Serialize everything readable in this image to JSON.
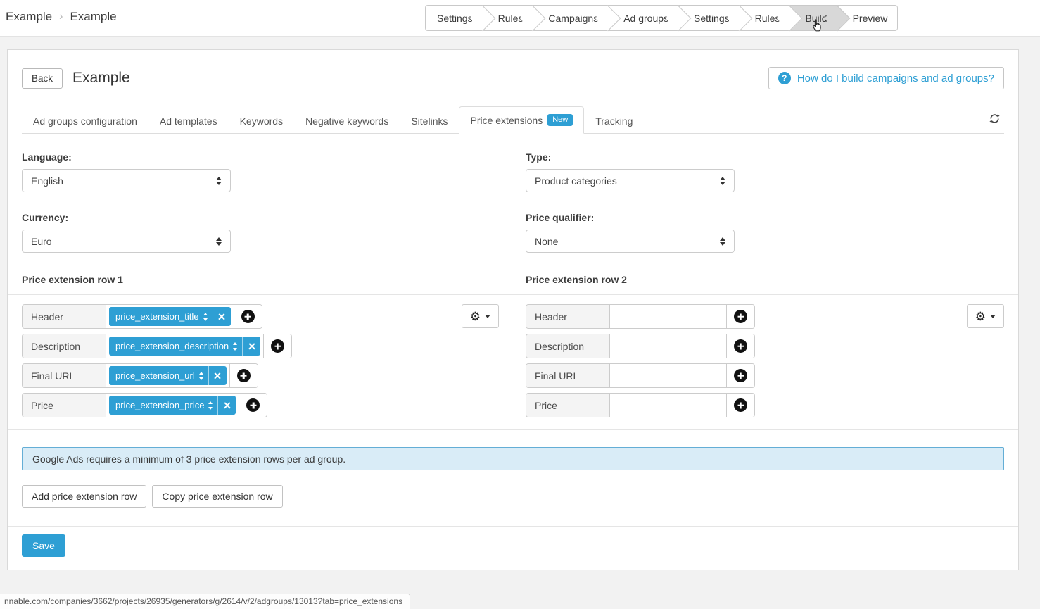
{
  "breadcrumb": {
    "items": [
      "Example",
      "Example"
    ],
    "separator": "›"
  },
  "wizard_nav": {
    "steps": [
      {
        "label": "Settings",
        "active": false
      },
      {
        "label": "Rules",
        "active": false
      },
      {
        "label": "Campaigns",
        "active": false
      },
      {
        "label": "Ad groups",
        "active": false
      },
      {
        "label": "Settings",
        "active": false
      },
      {
        "label": "Rules",
        "active": false
      },
      {
        "label": "Build",
        "active": true
      },
      {
        "label": "Preview",
        "active": false
      }
    ]
  },
  "header": {
    "back_label": "Back",
    "title": "Example",
    "help_label": "How do I build campaigns and ad groups?",
    "help_icon": "?"
  },
  "tabs": {
    "items": [
      {
        "label": "Ad groups configuration"
      },
      {
        "label": "Ad templates"
      },
      {
        "label": "Keywords"
      },
      {
        "label": "Negative keywords"
      },
      {
        "label": "Sitelinks"
      },
      {
        "label": "Price extensions",
        "badge": "New",
        "active": true
      },
      {
        "label": "Tracking"
      }
    ]
  },
  "form": {
    "language": {
      "label": "Language:",
      "value": "English"
    },
    "type": {
      "label": "Type:",
      "value": "Product categories"
    },
    "currency": {
      "label": "Currency:",
      "value": "Euro"
    },
    "price_qualifier": {
      "label": "Price qualifier:",
      "value": "None"
    }
  },
  "price_rows": [
    {
      "title": "Price extension row 1",
      "fields": [
        {
          "label": "Header",
          "tag": "price_extension_title"
        },
        {
          "label": "Description",
          "tag": "price_extension_description"
        },
        {
          "label": "Final URL",
          "tag": "price_extension_url"
        },
        {
          "label": "Price",
          "tag": "price_extension_price"
        }
      ]
    },
    {
      "title": "Price extension row 2",
      "fields": [
        {
          "label": "Header",
          "tag": ""
        },
        {
          "label": "Description",
          "tag": ""
        },
        {
          "label": "Final URL",
          "tag": ""
        },
        {
          "label": "Price",
          "tag": ""
        }
      ]
    }
  ],
  "alert": {
    "text": "Google Ads requires a minimum of 3 price extension rows per ad group."
  },
  "actions": {
    "add_row": "Add price extension row",
    "copy_row": "Copy price extension row",
    "save": "Save"
  },
  "status_bar": {
    "url": "nnable.com/companies/3662/projects/26935/generators/g/2614/v/2/adgroups/13013?tab=price_extensions"
  },
  "colors": {
    "accent": "#2e9fd4",
    "alert_bg": "#d9ecf7",
    "alert_border": "#64aed6",
    "active_step_bg": "#d8d8d8"
  }
}
